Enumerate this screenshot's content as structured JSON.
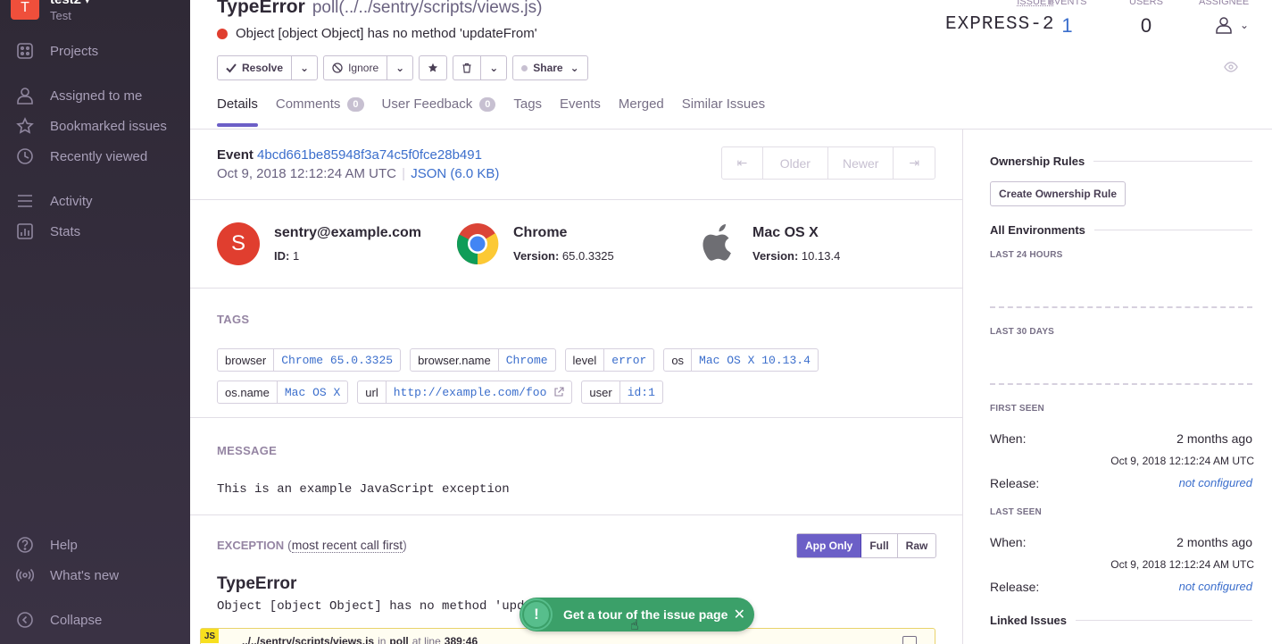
{
  "sidebar": {
    "org_initial": "T",
    "org_name": "test2",
    "org_sub": "Test",
    "items": [
      {
        "label": "Projects"
      },
      {
        "label": "Assigned to me"
      },
      {
        "label": "Bookmarked issues"
      },
      {
        "label": "Recently viewed"
      },
      {
        "label": "Activity"
      },
      {
        "label": "Stats"
      }
    ],
    "footer": [
      {
        "label": "Help"
      },
      {
        "label": "What's new"
      },
      {
        "label": "Collapse"
      }
    ]
  },
  "issue": {
    "type": "TypeError",
    "path": "poll(../../sentry/scripts/views.js)",
    "message": "Object [object Object] has no method 'updateFrom'"
  },
  "stats": {
    "issue_label": "ISSUE #",
    "issue_value": "EXPRESS-2",
    "events_label": "EVENTS",
    "events_value": "1",
    "users_label": "USERS",
    "users_value": "0",
    "assignee_label": "ASSIGNEE"
  },
  "toolbar": {
    "resolve": "Resolve",
    "ignore": "Ignore",
    "share": "Share"
  },
  "tabs": [
    {
      "label": "Details"
    },
    {
      "label": "Comments",
      "badge": "0"
    },
    {
      "label": "User Feedback",
      "badge": "0"
    },
    {
      "label": "Tags"
    },
    {
      "label": "Events"
    },
    {
      "label": "Merged"
    },
    {
      "label": "Similar Issues"
    }
  ],
  "event": {
    "label": "Event",
    "id": "4bcd661be85948f3a74c5f0fce28b491",
    "date": "Oct 9, 2018 12:12:24 AM UTC",
    "json": "JSON (6.0 KB)",
    "older": "Older",
    "newer": "Newer"
  },
  "context": {
    "user_initial": "S",
    "user_name": "sentry@example.com",
    "user_id_label": "ID:",
    "user_id": "1",
    "browser_name": "Chrome",
    "browser_version_label": "Version:",
    "browser_version": "65.0.3325",
    "os_name": "Mac OS X",
    "os_version_label": "Version:",
    "os_version": "10.13.4"
  },
  "tags_title": "TAGS",
  "tags": [
    {
      "key": "browser",
      "value": "Chrome 65.0.3325"
    },
    {
      "key": "browser.name",
      "value": "Chrome"
    },
    {
      "key": "level",
      "value": "error"
    },
    {
      "key": "os",
      "value": "Mac OS X 10.13.4"
    },
    {
      "key": "os.name",
      "value": "Mac OS X"
    },
    {
      "key": "url",
      "value": "http://example.com/foo"
    },
    {
      "key": "user",
      "value": "id:1"
    }
  ],
  "message_title": "MESSAGE",
  "message_text": "This is an example JavaScript exception",
  "exception": {
    "title": "EXCEPTION",
    "order": "most recent call first",
    "app_only": "App Only",
    "full": "Full",
    "raw": "Raw",
    "type": "TypeError",
    "value": "Object [object Object] has no method 'updateFrom'",
    "frame_badge": "JS",
    "frame_file": "../../sentry/scripts/views.js",
    "frame_in": "in",
    "frame_fn": "poll",
    "frame_at": "at line",
    "frame_line": "389:46"
  },
  "tour": {
    "label": "Get a tour of the issue page"
  },
  "right": {
    "ownership_title": "Ownership Rules",
    "create_rule": "Create Ownership Rule",
    "env_title": "All Environments",
    "last24": "LAST 24 HOURS",
    "last30": "LAST 30 DAYS",
    "first_seen": "FIRST SEEN",
    "last_seen": "LAST SEEN",
    "when_label": "When:",
    "when_value": "2 months ago",
    "when_date": "Oct 9, 2018 12:12:24 AM UTC",
    "release_label": "Release:",
    "release_value": "not configured",
    "linked_title": "Linked Issues"
  },
  "colors": {
    "accent": "#6c5fc7",
    "sidebar_bg": "#2f2936",
    "error": "#e03e2f",
    "tour": "#3ba069"
  }
}
